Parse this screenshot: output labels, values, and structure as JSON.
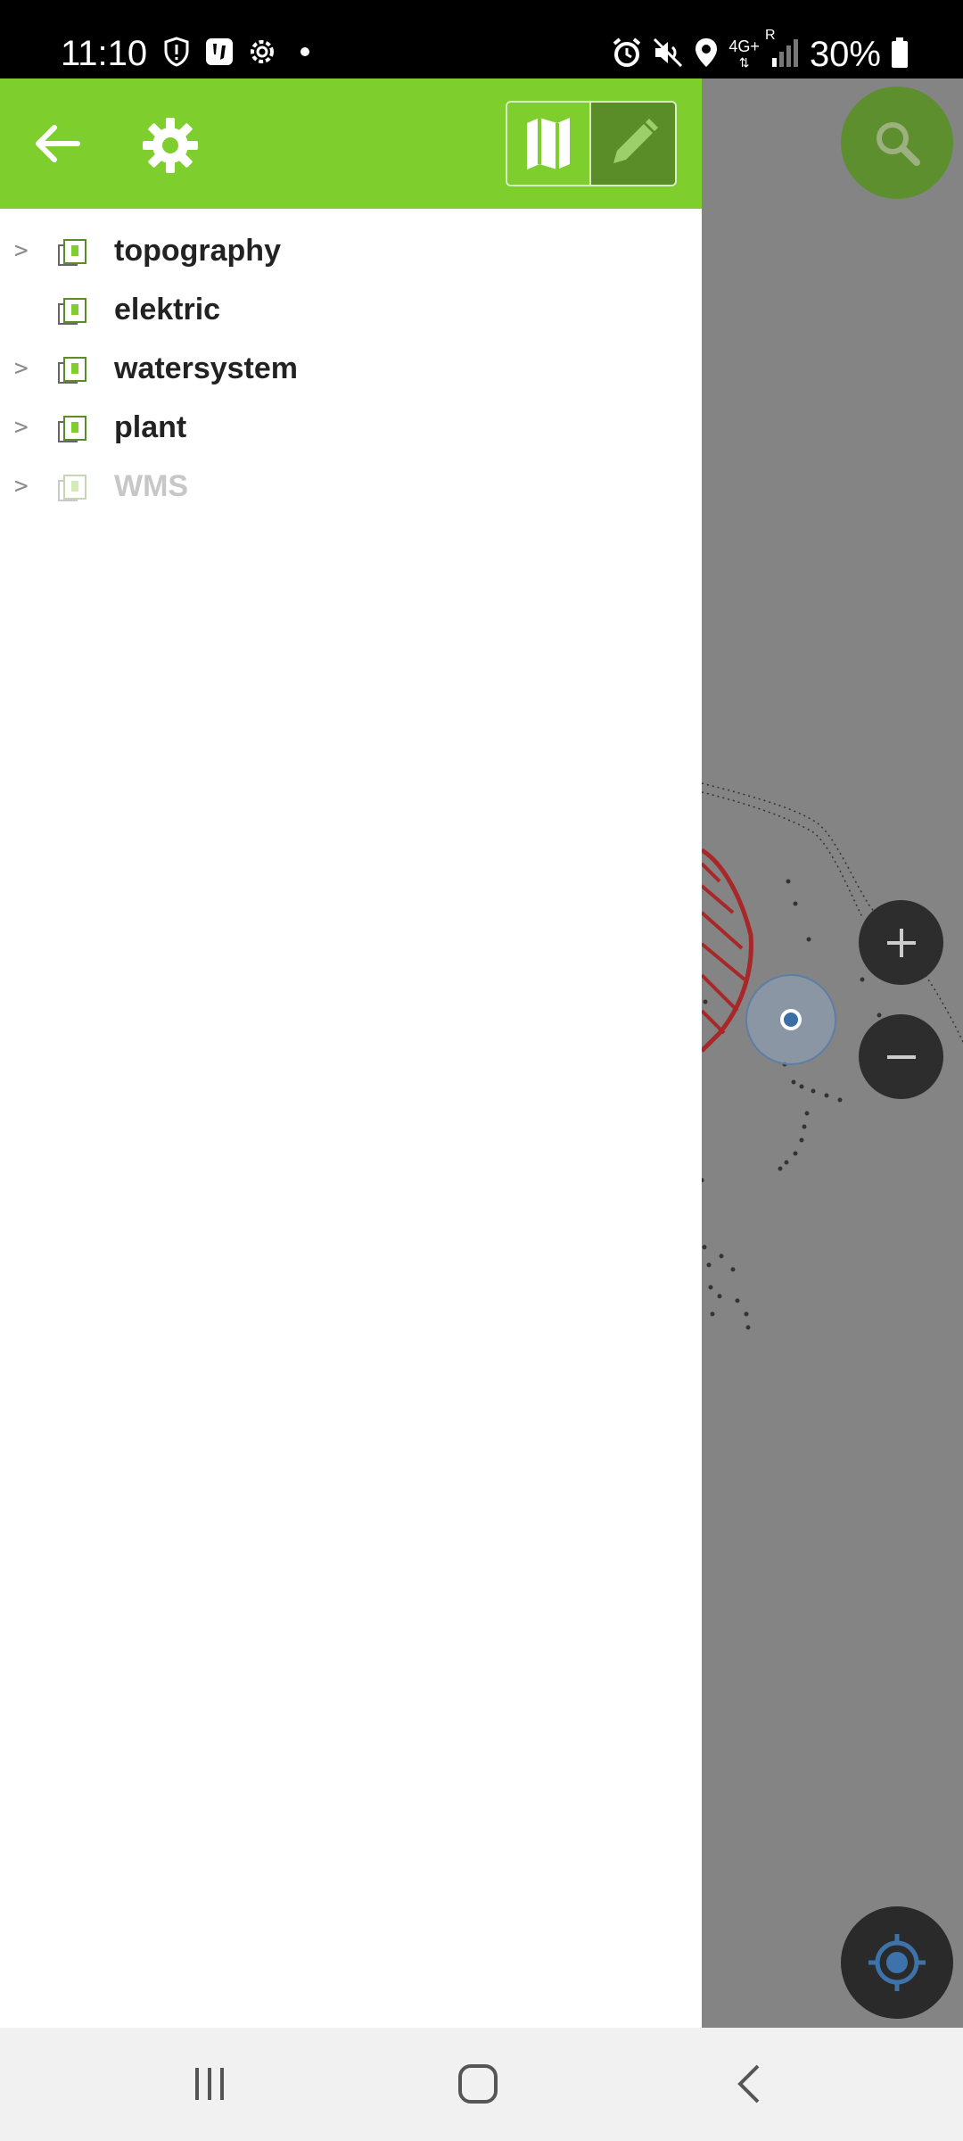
{
  "status_bar": {
    "time": "11:10",
    "left_icons": [
      "shield-icon",
      "notification-app-icon",
      "settings-gear-icon",
      "dot-icon"
    ],
    "right_icons": [
      "alarm-icon",
      "mute-icon",
      "location-icon",
      "4g-plus-icon",
      "signal-icon",
      "battery-icon"
    ],
    "network": "4G+",
    "roaming": "R",
    "battery": "30%"
  },
  "drawer": {
    "header_color": "#7ece2d",
    "back_icon": "arrow-left-icon",
    "settings_icon": "gear-icon",
    "mode_toggle": {
      "selected": "map",
      "options": [
        "map-icon",
        "pencil-icon"
      ]
    },
    "layers": [
      {
        "name": "topography",
        "expandable": true,
        "enabled": true
      },
      {
        "name": "elektric",
        "expandable": false,
        "enabled": true
      },
      {
        "name": "watersystem",
        "expandable": true,
        "enabled": true
      },
      {
        "name": "plant",
        "expandable": true,
        "enabled": true
      },
      {
        "name": "WMS",
        "expandable": true,
        "enabled": false
      }
    ],
    "expand_glyph": ">"
  },
  "map": {
    "background": "#848484",
    "controls": [
      "search-icon",
      "zoom-in-icon",
      "zoom-out-icon",
      "locate-icon"
    ]
  },
  "nav_bar": {
    "buttons": [
      "recents-icon",
      "home-icon",
      "back-icon"
    ]
  }
}
